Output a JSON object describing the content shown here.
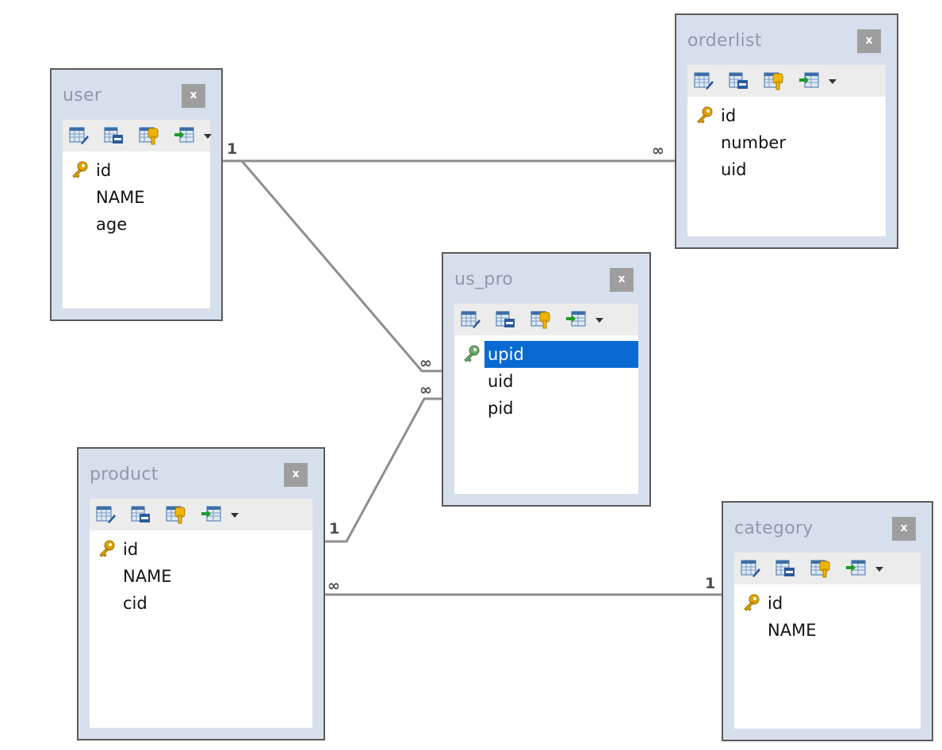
{
  "colors": {
    "frame_bg": "#d6e0ec",
    "frame_border": "#5a5a5a",
    "title_text": "#8e9aac",
    "line": "#8e8e8e",
    "selection": "#0a6ad4",
    "pk_key_gold": "#e0a100",
    "pk_key_green": "#6fa66f"
  },
  "toolbar_icons": [
    "edit-table-icon",
    "design-table-icon",
    "table-key-icon",
    "insert-field-icon",
    "dropdown-caret-icon"
  ],
  "tables": {
    "user": {
      "title": "user",
      "close": "x",
      "fields": [
        {
          "name": "id",
          "pk": true
        },
        {
          "name": "NAME",
          "pk": false
        },
        {
          "name": "age",
          "pk": false
        }
      ]
    },
    "orderlist": {
      "title": "orderlist",
      "close": "x",
      "fields": [
        {
          "name": "id",
          "pk": true
        },
        {
          "name": "number",
          "pk": false
        },
        {
          "name": "uid",
          "pk": false
        }
      ]
    },
    "us_pro": {
      "title": "us_pro",
      "close": "x",
      "fields": [
        {
          "name": "upid",
          "pk": true,
          "selected": true
        },
        {
          "name": "uid",
          "pk": false
        },
        {
          "name": "pid",
          "pk": false
        }
      ]
    },
    "product": {
      "title": "product",
      "close": "x",
      "fields": [
        {
          "name": "id",
          "pk": true
        },
        {
          "name": "NAME",
          "pk": false
        },
        {
          "name": "cid",
          "pk": false
        }
      ]
    },
    "category": {
      "title": "category",
      "close": "x",
      "fields": [
        {
          "name": "id",
          "pk": true
        },
        {
          "name": "NAME",
          "pk": false
        }
      ]
    }
  },
  "relations": [
    {
      "from": "user",
      "to": "orderlist",
      "from_card": "1",
      "to_card": "∞"
    },
    {
      "from": "user",
      "to": "us_pro",
      "from_card": "",
      "to_card": "∞"
    },
    {
      "from": "product",
      "to": "us_pro",
      "from_card": "1",
      "to_card": "∞"
    },
    {
      "from": "product",
      "to": "category",
      "from_card": "∞",
      "to_card": "1"
    }
  ]
}
